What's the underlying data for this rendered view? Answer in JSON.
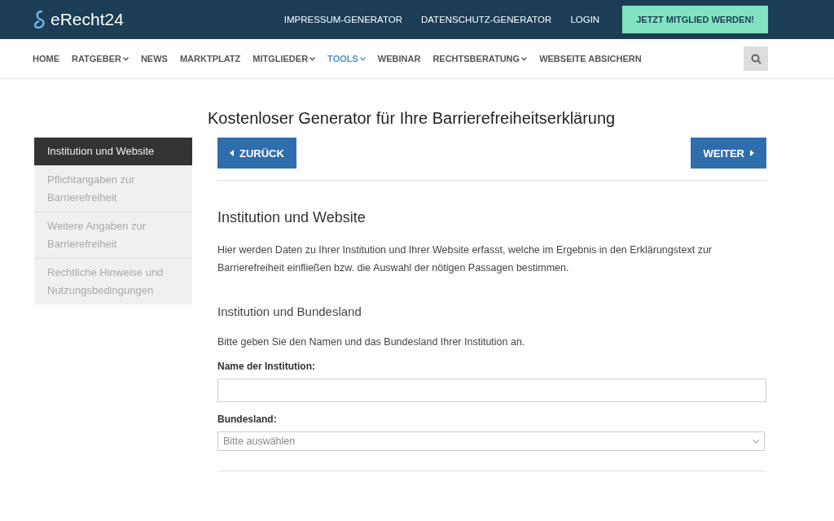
{
  "header": {
    "logo": "eRecht24",
    "links": [
      "IMPRESSUM-GENERATOR",
      "DATENSCHUTZ-GENERATOR",
      "LOGIN"
    ],
    "cta": "JETZT MITGLIED WERDEN!"
  },
  "nav": [
    {
      "label": "HOME",
      "dropdown": false,
      "selected": false
    },
    {
      "label": "RATGEBER",
      "dropdown": true,
      "selected": false
    },
    {
      "label": "NEWS",
      "dropdown": false,
      "selected": false
    },
    {
      "label": "MARKTPLATZ",
      "dropdown": false,
      "selected": false
    },
    {
      "label": "MITGLIEDER",
      "dropdown": true,
      "selected": false
    },
    {
      "label": "TOOLS",
      "dropdown": true,
      "selected": true
    },
    {
      "label": "WEBINAR",
      "dropdown": false,
      "selected": false
    },
    {
      "label": "RECHTSBERATUNG",
      "dropdown": true,
      "selected": false
    },
    {
      "label": "WEBSEITE ABSICHERN",
      "dropdown": false,
      "selected": false
    }
  ],
  "page_title": "Kostenloser Generator für Ihre Barrierefreiheitserklärung",
  "steps": [
    {
      "label": "Institution und Website",
      "selected": true
    },
    {
      "label": "Pflichtangaben zur Barrierefreiheit",
      "selected": false
    },
    {
      "label": "Weitere Angaben zur Barrierefreiheit",
      "selected": false
    },
    {
      "label": "Rechtliche Hinweise und Nutzungsbedingungen",
      "selected": false
    }
  ],
  "back_button": "ZURÜCK",
  "next_button": "WEITER",
  "section_title": "Institution und Website",
  "intro": "Hier werden Daten zu Ihrer Institution und Ihrer Website erfasst, welche im Ergebnis in den Erklärungstext zur Barrierefreiheit einfließen bzw. die Auswahl der nötigen Passagen bestimmen.",
  "subsection_title": "Institution und Bundesland",
  "subsection_text": "Bitte geben Sie den Namen und das Bundesland Ihrer Institution an.",
  "fields": [
    {
      "kind": "text",
      "label": "Name der Institution:"
    },
    {
      "kind": "select",
      "label": "Bundesland:",
      "placeholder": "Bitte auswählen"
    }
  ]
}
